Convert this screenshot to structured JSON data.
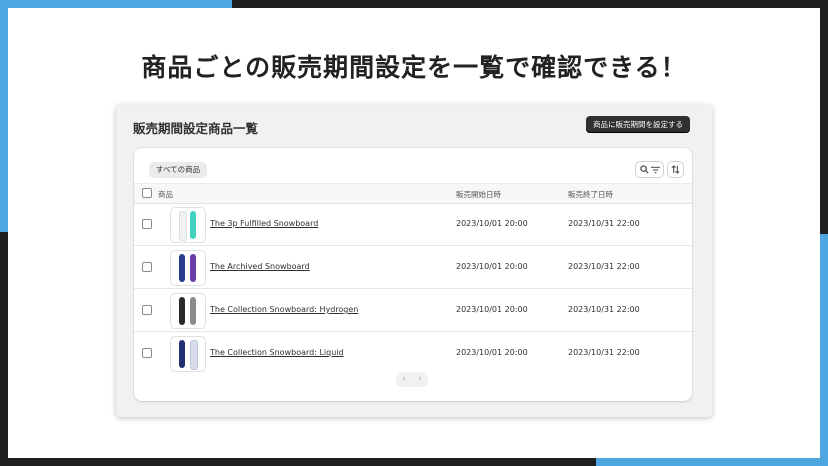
{
  "headline": "商品ごとの販売期間設定を一覧で確認できる！",
  "window": {
    "title": "販売期間設定商品一覧",
    "primary_button": "商品に販売期間を設定する"
  },
  "filters": {
    "all_tab": "すべての商品"
  },
  "table": {
    "headers": [
      "商品",
      "販売開始日時",
      "販売終了日時"
    ],
    "rows": [
      {
        "name": "The 3p Fulfilled Snowboard",
        "start": "2023/10/01 20:00",
        "end": "2023/10/31 22:00"
      },
      {
        "name": "The Archived Snowboard",
        "start": "2023/10/01 20:00",
        "end": "2023/10/31 22:00"
      },
      {
        "name": "The Collection Snowboard: Hydrogen",
        "start": "2023/10/01 20:00",
        "end": "2023/10/31 22:00"
      },
      {
        "name": "The Collection Snowboard: Liquid",
        "start": "2023/10/01 20:00",
        "end": "2023/10/31 22:00"
      }
    ]
  },
  "icons": {
    "search": "search-icon",
    "filter": "filter-icon",
    "sort": "sort-icon",
    "prev": "chevron-left-icon",
    "next": "chevron-right-icon"
  },
  "colors": {
    "accent": "#4ea6e0",
    "primary_button": "#303030"
  }
}
